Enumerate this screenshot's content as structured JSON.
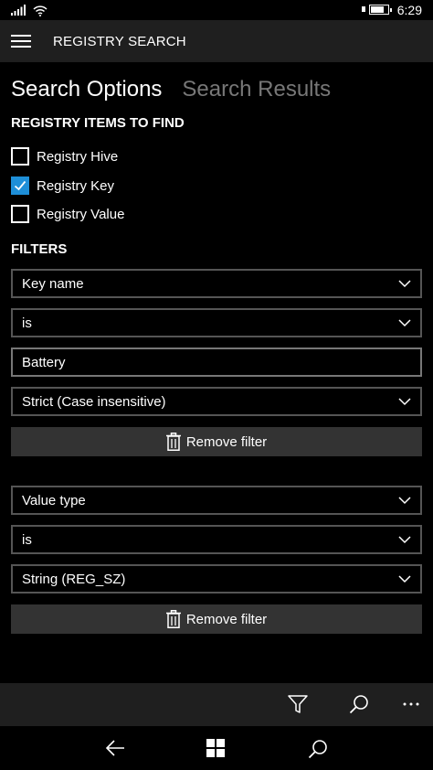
{
  "status": {
    "time": "6:29",
    "battery_percent": 80
  },
  "appbar": {
    "title": "REGISTRY SEARCH",
    "menu_icon": "hamburger-icon"
  },
  "pivot": {
    "tabs": [
      {
        "label": "Search Options",
        "active": true
      },
      {
        "label": "Search Results",
        "active": false
      }
    ]
  },
  "items_section": {
    "title": "REGISTRY ITEMS TO FIND",
    "options": [
      {
        "label": "Registry Hive",
        "checked": false
      },
      {
        "label": "Registry Key",
        "checked": true
      },
      {
        "label": "Registry Value",
        "checked": false
      }
    ]
  },
  "filters_section": {
    "title": "FILTERS",
    "filter1": {
      "field": "Key name",
      "operator": "is",
      "value": "Battery",
      "match": "Strict (Case insensitive)",
      "remove_label": "Remove filter"
    },
    "filter2": {
      "field": "Value type",
      "operator": "is",
      "value": "String (REG_SZ)",
      "remove_label": "Remove filter"
    }
  },
  "commandbar": {
    "icons": [
      "filter-icon",
      "search-icon",
      "more-icon"
    ]
  },
  "navbar": {
    "icons": [
      "back-icon",
      "windows-icon",
      "search-icon"
    ]
  },
  "colors": {
    "accent": "#1e8fd8",
    "appbar": "#1f1f1f",
    "button": "#333333",
    "border": "#555555"
  }
}
